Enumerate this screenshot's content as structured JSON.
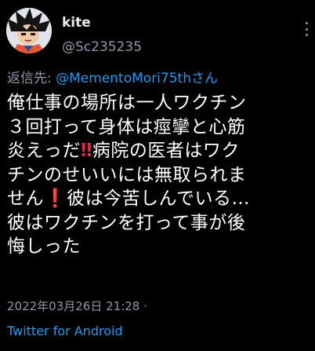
{
  "author": {
    "display_name": "kite",
    "handle": "@Sc235235",
    "avatar_icon": "anime-character-avatar"
  },
  "reply_to": {
    "prefix": "返信先: ",
    "mention": "@MementoMori75th",
    "suffix": "さん"
  },
  "tweet": {
    "lines": [
      {
        "parts": [
          {
            "text": "俺仕事の場所は一人ワクチン"
          }
        ]
      },
      {
        "parts": [
          {
            "text": "３回打って身体は痙攣と心筋"
          }
        ]
      },
      {
        "parts": [
          {
            "text": "炎えっだ"
          },
          {
            "text": "‼",
            "emoji": "double-exclamation-emoji"
          },
          {
            "text": "病院の医者はワク"
          }
        ]
      },
      {
        "parts": [
          {
            "text": "チンのせいいには無取られま"
          }
        ]
      },
      {
        "parts": [
          {
            "text": "せん"
          },
          {
            "text": "❗",
            "emoji": "exclamation-emoji"
          },
          {
            "text": "彼は今苦しんでいる…"
          }
        ]
      },
      {
        "parts": [
          {
            "text": "彼はワクチンを打って事が後"
          }
        ]
      },
      {
        "parts": [
          {
            "text": "悔しった"
          }
        ]
      }
    ]
  },
  "meta": {
    "timestamp": "2022年03月26日 21:28 ·",
    "source": "Twitter for Android"
  },
  "colors": {
    "background": "#000000",
    "text": "#ffffff",
    "secondary": "#8b98a5",
    "link": "#1d9bf0",
    "emoji_red": "#e2264d"
  }
}
